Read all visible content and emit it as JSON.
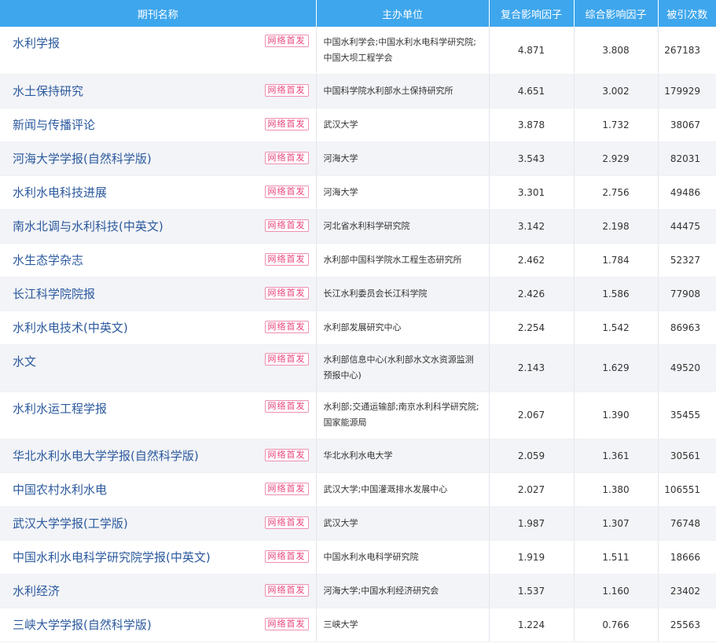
{
  "headers": {
    "name": "期刊名称",
    "org": "主办单位",
    "composite": "复合影响因子",
    "comprehensive": "综合影响因子",
    "cited": "被引次数"
  },
  "colors": {
    "header_bg": "#3ea6ec",
    "link": "#2c5a9e",
    "badge": "#e8447c"
  },
  "rows": [
    {
      "name": "水利学报",
      "badge": "网络首发",
      "org": "中国水利学会;中国水利水电科学研究院;中国大坝工程学会",
      "composite": "4.871",
      "comprehensive": "3.808",
      "cited": "267183"
    },
    {
      "name": "水土保持研究",
      "badge": "网络首发",
      "org": "中国科学院水利部水土保持研究所",
      "composite": "4.651",
      "comprehensive": "3.002",
      "cited": "179929"
    },
    {
      "name": "新闻与传播评论",
      "badge": "网络首发",
      "org": "武汉大学",
      "composite": "3.878",
      "comprehensive": "1.732",
      "cited": "38067"
    },
    {
      "name": "河海大学学报(自然科学版)",
      "badge": "网络首发",
      "org": "河海大学",
      "composite": "3.543",
      "comprehensive": "2.929",
      "cited": "82031"
    },
    {
      "name": "水利水电科技进展",
      "badge": "网络首发",
      "org": "河海大学",
      "composite": "3.301",
      "comprehensive": "2.756",
      "cited": "49486"
    },
    {
      "name": "南水北调与水利科技(中英文)",
      "badge": "网络首发",
      "org": "河北省水利科学研究院",
      "composite": "3.142",
      "comprehensive": "2.198",
      "cited": "44475"
    },
    {
      "name": "水生态学杂志",
      "badge": "网络首发",
      "org": "水利部中国科学院水工程生态研究所",
      "composite": "2.462",
      "comprehensive": "1.784",
      "cited": "52327"
    },
    {
      "name": "长江科学院院报",
      "badge": "网络首发",
      "org": "长江水利委员会长江科学院",
      "composite": "2.426",
      "comprehensive": "1.586",
      "cited": "77908"
    },
    {
      "name": "水利水电技术(中英文)",
      "badge": "网络首发",
      "org": "水利部发展研究中心",
      "composite": "2.254",
      "comprehensive": "1.542",
      "cited": "86963"
    },
    {
      "name": "水文",
      "badge": "网络首发",
      "org": "水利部信息中心(水利部水文水资源监测预报中心)",
      "composite": "2.143",
      "comprehensive": "1.629",
      "cited": "49520"
    },
    {
      "name": "水利水运工程学报",
      "badge": "网络首发",
      "org": "水利部;交通运输部;南京水利科学研究院;国家能源局",
      "composite": "2.067",
      "comprehensive": "1.390",
      "cited": "35455"
    },
    {
      "name": "华北水利水电大学学报(自然科学版)",
      "badge": "网络首发",
      "org": "华北水利水电大学",
      "composite": "2.059",
      "comprehensive": "1.361",
      "cited": "30561"
    },
    {
      "name": "中国农村水利水电",
      "badge": "网络首发",
      "org": "武汉大学;中国灌溉排水发展中心",
      "composite": "2.027",
      "comprehensive": "1.380",
      "cited": "106551"
    },
    {
      "name": "武汉大学学报(工学版)",
      "badge": "网络首发",
      "org": "武汉大学",
      "composite": "1.987",
      "comprehensive": "1.307",
      "cited": "76748"
    },
    {
      "name": "中国水利水电科学研究院学报(中英文)",
      "badge": "网络首发",
      "org": "中国水利水电科学研究院",
      "composite": "1.919",
      "comprehensive": "1.511",
      "cited": "18666"
    },
    {
      "name": "水利经济",
      "badge": "网络首发",
      "org": "河海大学;中国水利经济研究会",
      "composite": "1.537",
      "comprehensive": "1.160",
      "cited": "23402"
    },
    {
      "name": "三峡大学学报(自然科学版)",
      "badge": "网络首发",
      "org": "三峡大学",
      "composite": "1.224",
      "comprehensive": "0.766",
      "cited": "25563"
    }
  ]
}
